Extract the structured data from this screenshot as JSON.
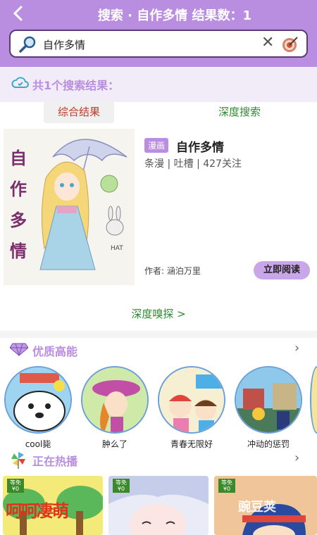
{
  "header": {
    "title": "搜索 · 自作多情 结果数：1",
    "search_query": "自作多情"
  },
  "results": {
    "count_text": "共1个搜索结果：",
    "tabs": [
      "综合结果",
      "深度搜索"
    ]
  },
  "comic": {
    "badge": "漫画",
    "title": "自作多情",
    "meta": "条漫 | 吐槽 | 427关注",
    "cover_text": [
      "自",
      "作",
      "多",
      "情"
    ],
    "author": "作者:  涵泊万里",
    "read_button": "立即阅读"
  },
  "deep_probe": "深度嗅探 >",
  "quality": {
    "title": "优质高能",
    "items": [
      {
        "label": "cool毙"
      },
      {
        "label": "肿么了"
      },
      {
        "label": "青春无限好"
      },
      {
        "label": "冲动的惩罚"
      }
    ]
  },
  "hot": {
    "title": "正在热播",
    "free_tag": "等免 ¥0",
    "watermark": "豌豆荚",
    "thumb1_text": "呵呵凄萌"
  },
  "colors": {
    "accent": "#b98ee0",
    "green": "#2e8b2e",
    "red": "#c0392b"
  }
}
